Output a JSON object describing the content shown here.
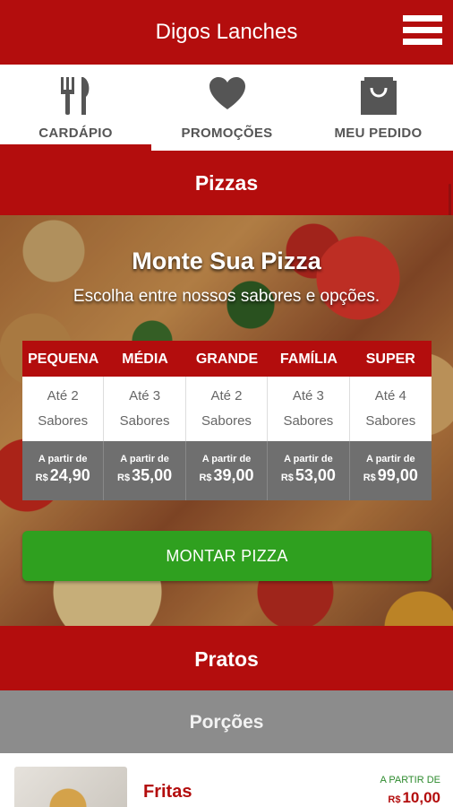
{
  "app": {
    "title": "Digos Lanches"
  },
  "tabs": [
    {
      "label": "CARDÁPIO",
      "icon": "fork-knife-icon",
      "active": true
    },
    {
      "label": "PROMOÇÕES",
      "icon": "heart-icon",
      "active": false
    },
    {
      "label": "MEU PEDIDO",
      "icon": "shopping-bag-icon",
      "active": false
    }
  ],
  "sections": {
    "pizzas": "Pizzas",
    "pratos": "Pratos",
    "porcoes": "Porções"
  },
  "hero": {
    "title": "Monte Sua Pizza",
    "subtitle": "Escolha entre nossos sabores e opções."
  },
  "sizes": [
    {
      "name": "PEQUENA",
      "flavors_line1": "Até 2",
      "flavors_line2": "Sabores",
      "from": "A partir de",
      "currency": "R$",
      "price": "24,90"
    },
    {
      "name": "MÉDIA",
      "flavors_line1": "Até 3",
      "flavors_line2": "Sabores",
      "from": "A partir de",
      "currency": "R$",
      "price": "35,00"
    },
    {
      "name": "GRANDE",
      "flavors_line1": "Até 2",
      "flavors_line2": "Sabores",
      "from": "A partir de",
      "currency": "R$",
      "price": "39,00"
    },
    {
      "name": "FAMÍLIA",
      "flavors_line1": "Até 3",
      "flavors_line2": "Sabores",
      "from": "A partir de",
      "currency": "R$",
      "price": "53,00"
    },
    {
      "name": "SUPER",
      "flavors_line1": "Até 4",
      "flavors_line2": "Sabores",
      "from": "A partir de",
      "currency": "R$",
      "price": "99,00"
    }
  ],
  "montar_button": "MONTAR PIZZA",
  "item": {
    "name": "Fritas",
    "from": "A PARTIR DE",
    "currency": "R$",
    "price": "10,00"
  },
  "colors": {
    "brand_red": "#b30d0d",
    "green": "#2fa01f",
    "gray": "#8c8c8c"
  }
}
